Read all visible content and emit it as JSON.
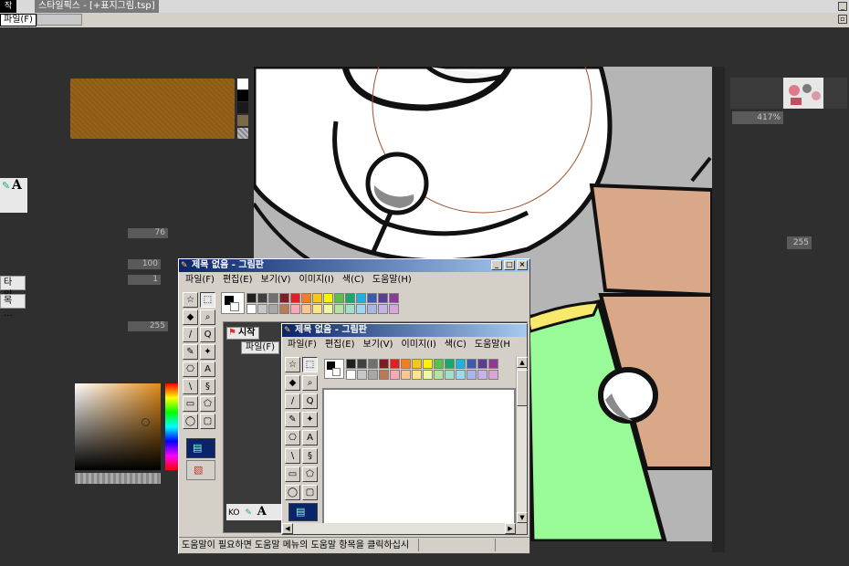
{
  "app": {
    "title": "스타일픽스 - [+표지그림.tsp]",
    "left_tab": "작",
    "file_menu": "파일(F)",
    "min_glyph": "_",
    "close_glyph": "▫"
  },
  "left_panel": {
    "tool_glyph": "A",
    "field_76": "76",
    "field_100": "100",
    "field_1": "1",
    "field_255": "255",
    "btn_file": "타일...",
    "btn_item": "목 ..."
  },
  "right_panel": {
    "zoom": "417%",
    "value": "255"
  },
  "colors": {
    "brown": "#8b5a14",
    "bg": "#2f2f2f",
    "paint_green": "#98fb98",
    "paint_tan": "#d8a889"
  },
  "paint_outer": {
    "title": "제목 없음 - 그림판",
    "menus": [
      "파일(F)",
      "편집(E)",
      "보기(V)",
      "이미지(I)",
      "색(C)",
      "도움말(H)"
    ],
    "status": "도움말이 필요하면 도움말 메뉴의 도움말 항목을 클릭하십시",
    "start_btn": "시작",
    "start_file": "파일(F)",
    "ko_label": "KO",
    "ko_glyph": "A",
    "tool_glyphs": [
      "☆",
      "⬚",
      "◆",
      "⌕",
      "∕",
      "Q",
      "✎",
      "✦",
      "⎔",
      "A",
      "\\",
      "§",
      "▭",
      "⬠",
      "◯",
      "▢"
    ]
  },
  "paint_inner": {
    "title": "제목 없음 - 그림판",
    "menus": [
      "파일(F)",
      "편집(E)",
      "보기(V)",
      "이미지(I)",
      "색(C)",
      "도움말(H"
    ]
  },
  "palette": {
    "row1": [
      "#000000",
      "#808080",
      "#800000",
      "#808000",
      "#008000",
      "#008080",
      "#000080",
      "#800080",
      "#808040",
      "#004040",
      "#0080ff",
      "#004080",
      "#8000ff",
      "#804000"
    ],
    "row2": [
      "#ffffff",
      "#c0c0c0",
      "#ff0000",
      "#ffff00",
      "#00ff00",
      "#00ffff",
      "#0000ff",
      "#ff00ff",
      "#ffff80",
      "#00ff80",
      "#80ffff",
      "#8080ff",
      "#ff0080",
      "#ff8040"
    ]
  },
  "palette_outer": {
    "row1": [
      "#202020",
      "#404040",
      "#707070",
      "#7b1f24",
      "#e31e24",
      "#f07f23",
      "#f6c61c",
      "#fff200",
      "#5dbf4a",
      "#1aa66f",
      "#22aee0",
      "#3d5bae",
      "#5a3e96",
      "#8b3a98"
    ],
    "row2": [
      "#ffffff",
      "#c8c8c8",
      "#a8a8a8",
      "#b97a57",
      "#f7a9b8",
      "#f8c890",
      "#fde68a",
      "#eff7a4",
      "#b5e4a2",
      "#a0e0c8",
      "#9fd8ee",
      "#a8b8e6",
      "#c6b4e6",
      "#d8a6d8"
    ]
  }
}
